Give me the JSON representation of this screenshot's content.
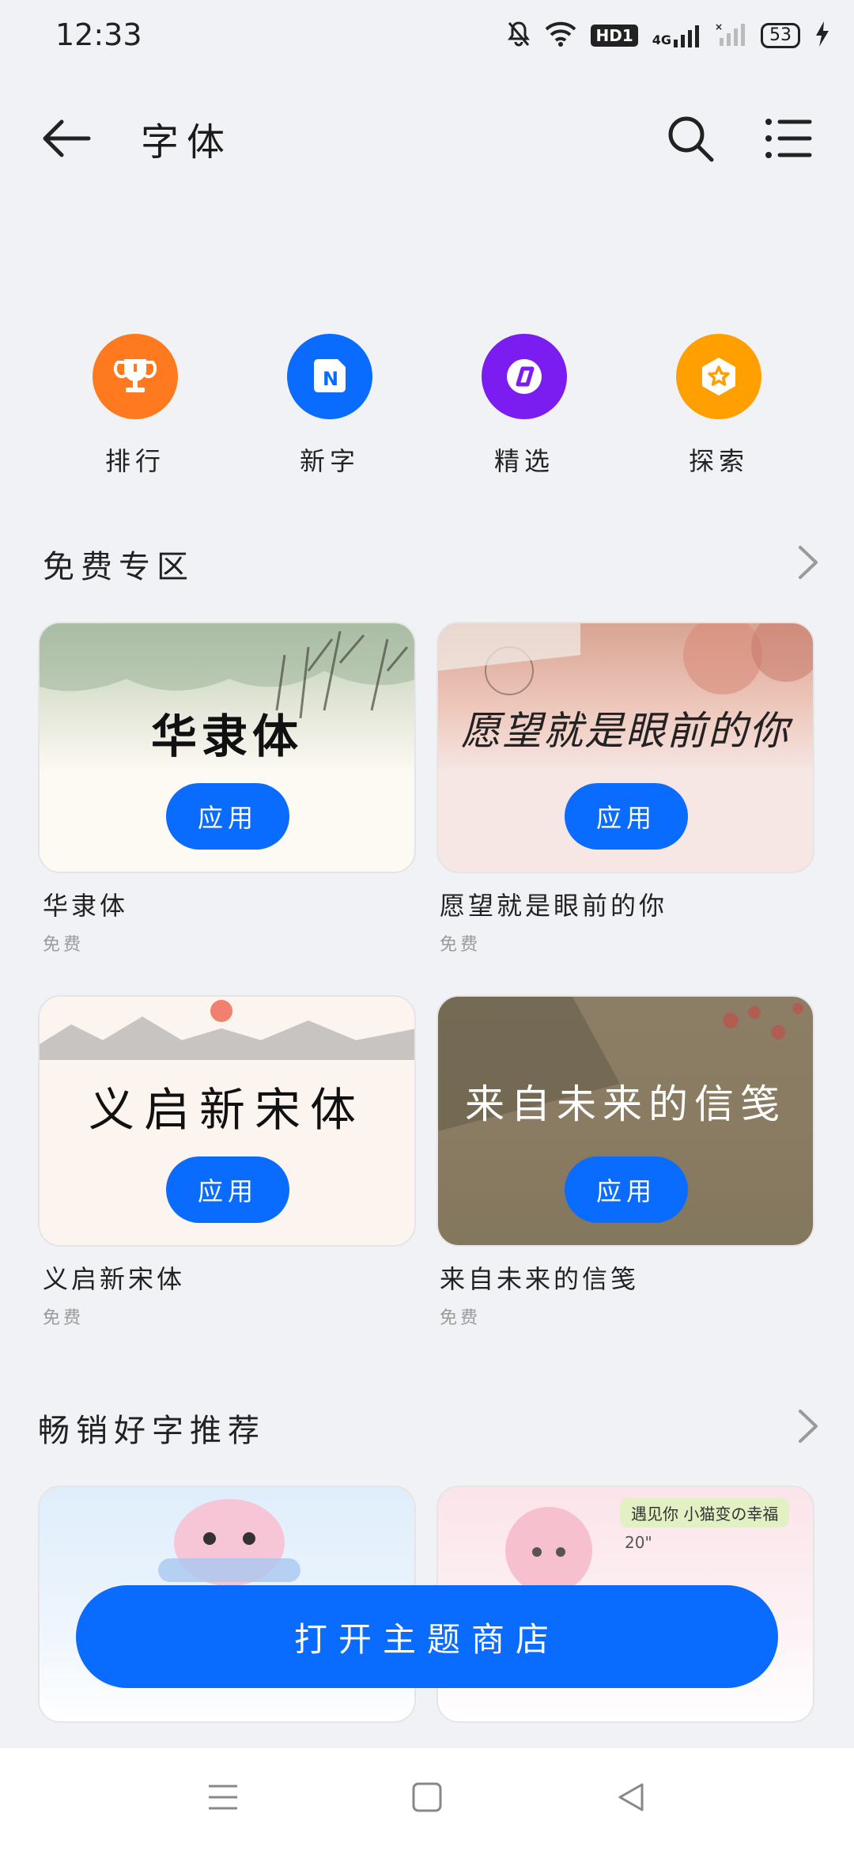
{
  "status": {
    "time": "12:33",
    "hd_label": "HD1",
    "net_label": "4G",
    "battery": "53"
  },
  "header": {
    "title": "字体"
  },
  "categories": [
    {
      "label": "排行",
      "icon": "trophy-icon",
      "color": "#ff7a1e"
    },
    {
      "label": "新字",
      "icon": "new-icon",
      "color": "#0a6bff"
    },
    {
      "label": "精选",
      "icon": "diamond-icon",
      "color": "#7b1df0"
    },
    {
      "label": "探索",
      "icon": "star-badge-icon",
      "color": "#ffa000"
    }
  ],
  "free_section": {
    "title": "免费专区",
    "items": [
      {
        "preview": "华隶体",
        "button": "应用",
        "name": "华隶体",
        "price": "免费"
      },
      {
        "preview": "愿望就是眼前的你",
        "button": "应用",
        "name": "愿望就是眼前的你",
        "price": "免费"
      },
      {
        "preview": "义启新宋体",
        "button": "应用",
        "name": "义启新宋体",
        "price": "免费"
      },
      {
        "preview": "来自未来的信笺",
        "button": "应用",
        "name": "来自未来的信笺",
        "price": "免费"
      }
    ]
  },
  "bestseller_section": {
    "title": "畅销好字推荐",
    "items": [
      {
        "tag": ""
      },
      {
        "tag": "遇见你 小猫变の幸福",
        "sub": "20\""
      }
    ]
  },
  "store_button": "打开主题商店",
  "colors": {
    "accent": "#0a6bff",
    "background": "#f1f2f5"
  }
}
